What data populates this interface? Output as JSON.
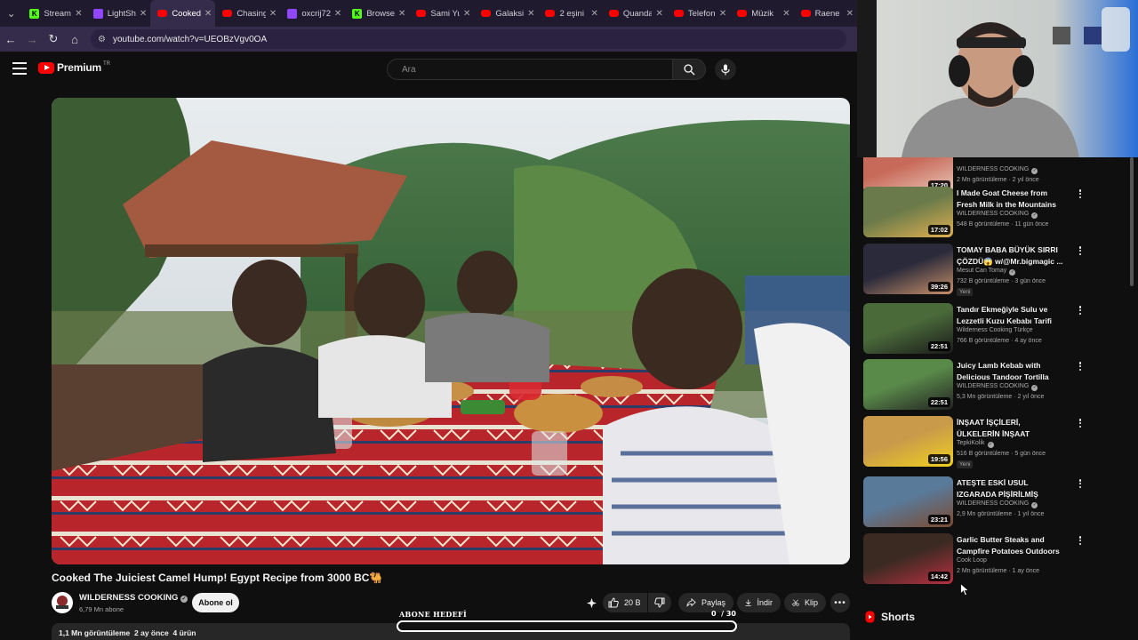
{
  "browser": {
    "tabs": [
      {
        "title": "Stream",
        "favicon": "kick",
        "color": "#53fc18"
      },
      {
        "title": "LightSh",
        "favicon": "twitch",
        "color": "#9146ff"
      },
      {
        "title": "Cooked",
        "favicon": "youtube",
        "color": "#ff0000",
        "active": true
      },
      {
        "title": "Chasing",
        "favicon": "youtube",
        "color": "#ff0000"
      },
      {
        "title": "oxcrij72",
        "favicon": "twitch",
        "color": "#9146ff"
      },
      {
        "title": "Browse",
        "favicon": "kick",
        "color": "#53fc18"
      },
      {
        "title": "Sami Yu",
        "favicon": "youtube",
        "color": "#ff0000"
      },
      {
        "title": "Galaksi",
        "favicon": "youtube",
        "color": "#ff0000"
      },
      {
        "title": "2 eşini",
        "favicon": "youtube",
        "color": "#ff0000"
      },
      {
        "title": "Quanda",
        "favicon": "youtube",
        "color": "#ff0000"
      },
      {
        "title": "Telefon",
        "favicon": "youtube",
        "color": "#ff0000"
      },
      {
        "title": "Müzik",
        "favicon": "youtube",
        "color": "#ff0000"
      },
      {
        "title": "Raene",
        "favicon": "youtube",
        "color": "#ff0000"
      }
    ],
    "url": "youtube.com/watch?v=UEOBzVgv0OA"
  },
  "header": {
    "logo_text": "Premium",
    "logo_region": "TR",
    "search_placeholder": "Ara"
  },
  "video": {
    "title": "Cooked The Juiciest Camel Hump! Egypt Recipe from 3000 BC🐫",
    "channel_name": "WILDERNESS COOKING",
    "subscribers": "6,79 Mn abone",
    "subscribe_label": "Abone ol",
    "likes": "20 B",
    "share_label": "Paylaş",
    "download_label": "İndir",
    "clip_label": "Klip",
    "meta": "1,1 Mn görüntüleme  2 ay önce  4 ürün"
  },
  "overlay_goal": {
    "label": "ABONE HEDEFİ",
    "count": "0  / 30",
    "progress": 0
  },
  "recommendations": [
    {
      "title": "",
      "channel": "WILDERNESS COOKING",
      "verified": true,
      "meta": "2 Mn görüntüleme · 2 yıl önce",
      "duration": "17:20",
      "thumb": "meat"
    },
    {
      "title": "I Made Goat Cheese from Fresh Milk in the Mountains",
      "channel": "WILDERNESS COOKING",
      "verified": true,
      "meta": "548 B görüntüleme · 11 gün önce",
      "duration": "17:02",
      "thumb": "cheese"
    },
    {
      "title": "TOMAY BABA BÜYÜK SIRRI ÇÖZDÜ😱 w/@Mr.bigmagic ...",
      "channel": "Mesut Can Tomay",
      "verified": true,
      "meta": "732 B görüntüleme · 3 gün önce",
      "duration": "39:26",
      "badge": "Yeni",
      "thumb": "people"
    },
    {
      "title": "Tandır Ekmeğiyle Sulu ve Lezzetli Kuzu Kebabı Tarifi",
      "channel": "Wilderness Cooking Türkçe",
      "verified": false,
      "meta": "766 B görüntüleme · 4 ay önce",
      "duration": "22:51",
      "thumb": "goat"
    },
    {
      "title": "Juicy Lamb Kebab with Delicious Tandoor Tortilla",
      "channel": "WILDERNESS COOKING",
      "verified": true,
      "meta": "5,3 Mn görüntüleme · 2 yıl önce",
      "duration": "22:51",
      "thumb": "goat2"
    },
    {
      "title": "İNŞAAT İŞÇİLERİ, ÜLKELERİN İNŞAAT YEMEKLERİNİ ...",
      "channel": "TepkiKolik",
      "verified": true,
      "meta": "516 B görüntüleme · 5 gün önce",
      "duration": "19:56",
      "badge": "Yeni",
      "thumb": "worker"
    },
    {
      "title": "ATEŞTE ESKİ USUL IZGARADA PİŞİRİLMİŞ BÜTÜN KUZU! | ÇO...",
      "channel": "WILDERNESS COOKING",
      "verified": true,
      "meta": "2,9 Mn görüntüleme · 1 yıl önce",
      "duration": "23:21",
      "thumb": "lamb"
    },
    {
      "title": "Garlic Butter Steaks and Campfire Potatoes Outdoors",
      "channel": "Cook Loop",
      "verified": false,
      "meta": "2 Mn görüntüleme · 1 ay önce",
      "duration": "14:42",
      "thumb": "steak"
    }
  ],
  "shorts_title": "Shorts",
  "colors": {
    "accent": "#ff0000",
    "background": "#0f0f0f",
    "tabbar": "#1f1a2e"
  }
}
